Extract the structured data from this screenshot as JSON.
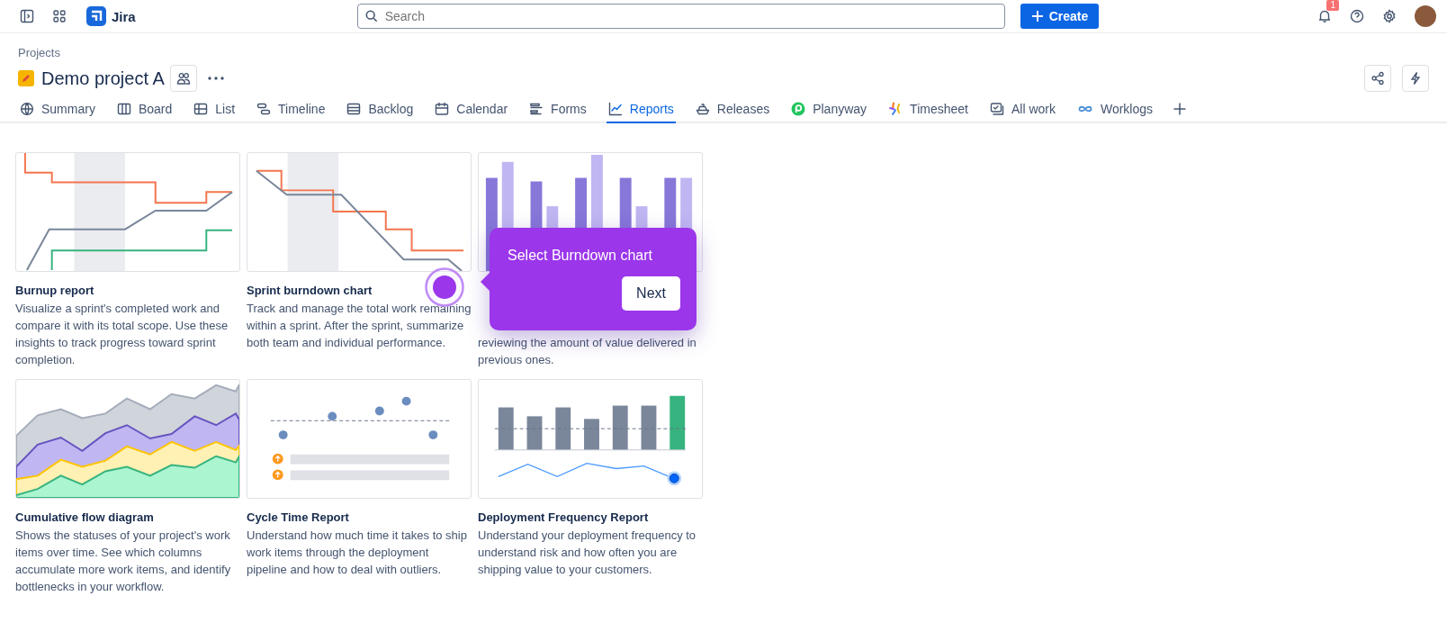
{
  "topbar": {
    "product": "Jira",
    "search": {
      "placeholder": "Search"
    },
    "create_button": "Create",
    "notification_count": "1"
  },
  "breadcrumb": "Projects",
  "project": {
    "title": "Demo project A"
  },
  "tabs": [
    {
      "label": "Summary",
      "selected": false
    },
    {
      "label": "Board",
      "selected": false
    },
    {
      "label": "List",
      "selected": false
    },
    {
      "label": "Timeline",
      "selected": false
    },
    {
      "label": "Backlog",
      "selected": false
    },
    {
      "label": "Calendar",
      "selected": false
    },
    {
      "label": "Forms",
      "selected": false
    },
    {
      "label": "Reports",
      "selected": true
    },
    {
      "label": "Releases",
      "selected": false
    },
    {
      "label": "Planyway",
      "selected": false
    },
    {
      "label": "Timesheet",
      "selected": false
    },
    {
      "label": "All work",
      "selected": false
    },
    {
      "label": "Worklogs",
      "selected": false
    }
  ],
  "reports": [
    {
      "kind": "burnup",
      "title": "Burnup report",
      "description": "Visualize a sprint's completed work and compare it with its total scope. Use these insights to track progress toward sprint completion."
    },
    {
      "kind": "burndown",
      "title": "Sprint burndown chart",
      "description": "Track and manage the total work remaining within a sprint. After the sprint, summarize both team and individual performance."
    },
    {
      "kind": "velocity",
      "description": "reviewing the amount of value delivered in previous ones."
    },
    {
      "kind": "cfd",
      "title": "Cumulative flow diagram",
      "description": "Shows the statuses of your project's work items over time. See which columns accumulate more work items, and identify bottlenecks in your workflow."
    },
    {
      "kind": "cycle",
      "title": "Cycle Time Report",
      "description": "Understand how much time it takes to ship work items through the deployment pipeline and how to deal with outliers."
    },
    {
      "kind": "deployment",
      "title": "Deployment Frequency Report",
      "description": "Understand your deployment frequency to understand risk and how often you are shipping value to your customers."
    }
  ],
  "tooltip": {
    "text": "Select Burndown chart",
    "button": "Next"
  }
}
